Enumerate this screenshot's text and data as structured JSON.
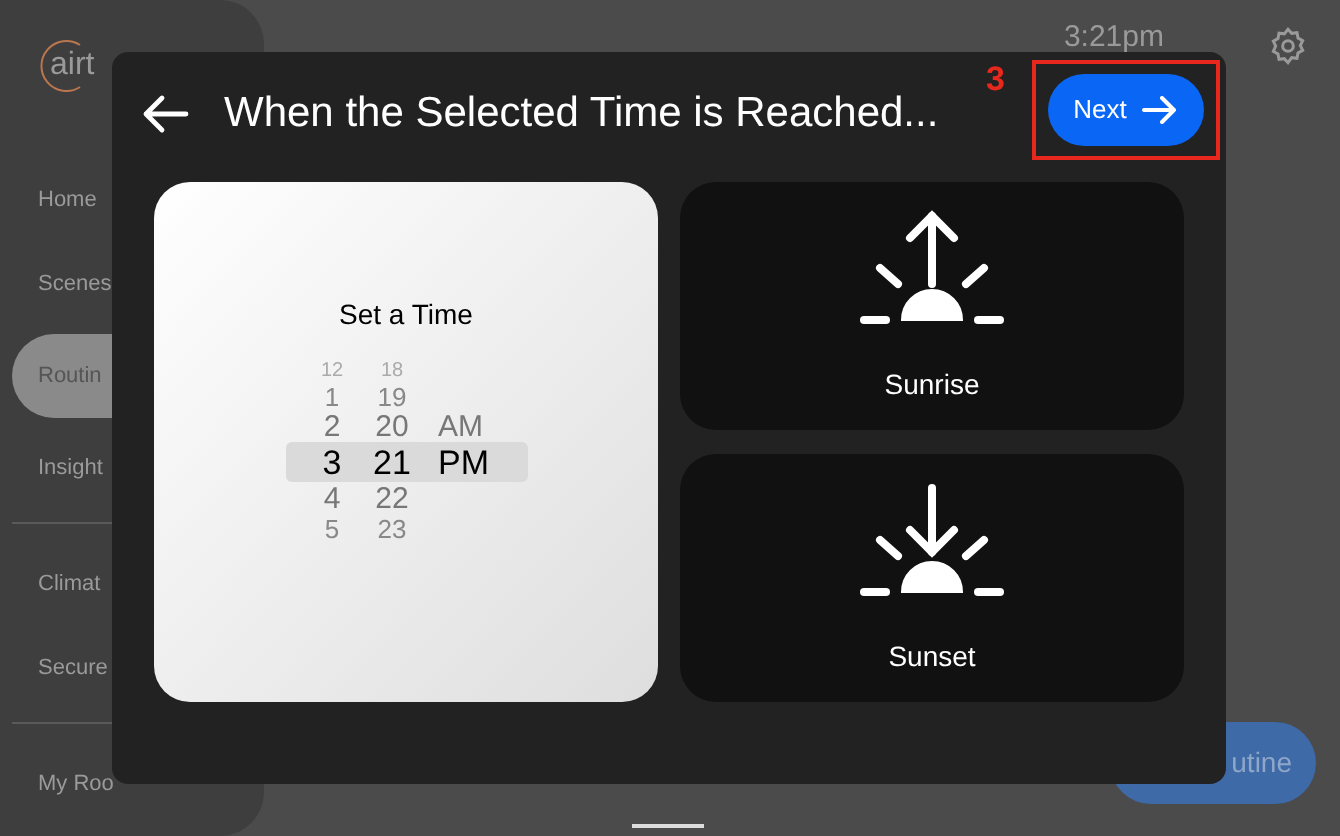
{
  "sidebar": {
    "logo": "airt",
    "groups": [
      [
        {
          "label": "Home",
          "selected": false
        },
        {
          "label": "Scenes",
          "selected": false
        },
        {
          "label": "Routin",
          "selected": true
        },
        {
          "label": "Insight",
          "selected": false
        }
      ],
      [
        {
          "label": "Climat",
          "selected": false
        },
        {
          "label": "Secure",
          "selected": false
        }
      ],
      [
        {
          "label": "My Roo",
          "selected": false
        }
      ]
    ]
  },
  "header": {
    "time": "3:21pm"
  },
  "footer_button": {
    "label": "utine"
  },
  "dialog": {
    "title": "When the Selected Time is Reached...",
    "next_button": "Next",
    "callout": "3",
    "options": [
      {
        "kind": "time",
        "title": "Set a Time",
        "selected": true,
        "picker": {
          "columns": [
            [
              {
                "label": "12",
                "selected": false
              },
              {
                "label": "1",
                "selected": false
              },
              {
                "label": "2",
                "selected": false
              },
              {
                "label": "3",
                "selected": true
              },
              {
                "label": "4",
                "selected": false
              },
              {
                "label": "5",
                "selected": false
              }
            ],
            [
              {
                "label": "18",
                "selected": false
              },
              {
                "label": "19",
                "selected": false
              },
              {
                "label": "20",
                "selected": false
              },
              {
                "label": "21",
                "selected": true
              },
              {
                "label": "22",
                "selected": false
              },
              {
                "label": "23",
                "selected": false
              }
            ],
            [
              {
                "label": "AM",
                "selected": false
              },
              {
                "label": "PM",
                "selected": true
              }
            ]
          ]
        }
      },
      {
        "kind": "sunrise",
        "title": "Sunrise",
        "selected": false
      },
      {
        "kind": "sunset",
        "title": "Sunset",
        "selected": false
      }
    ]
  }
}
